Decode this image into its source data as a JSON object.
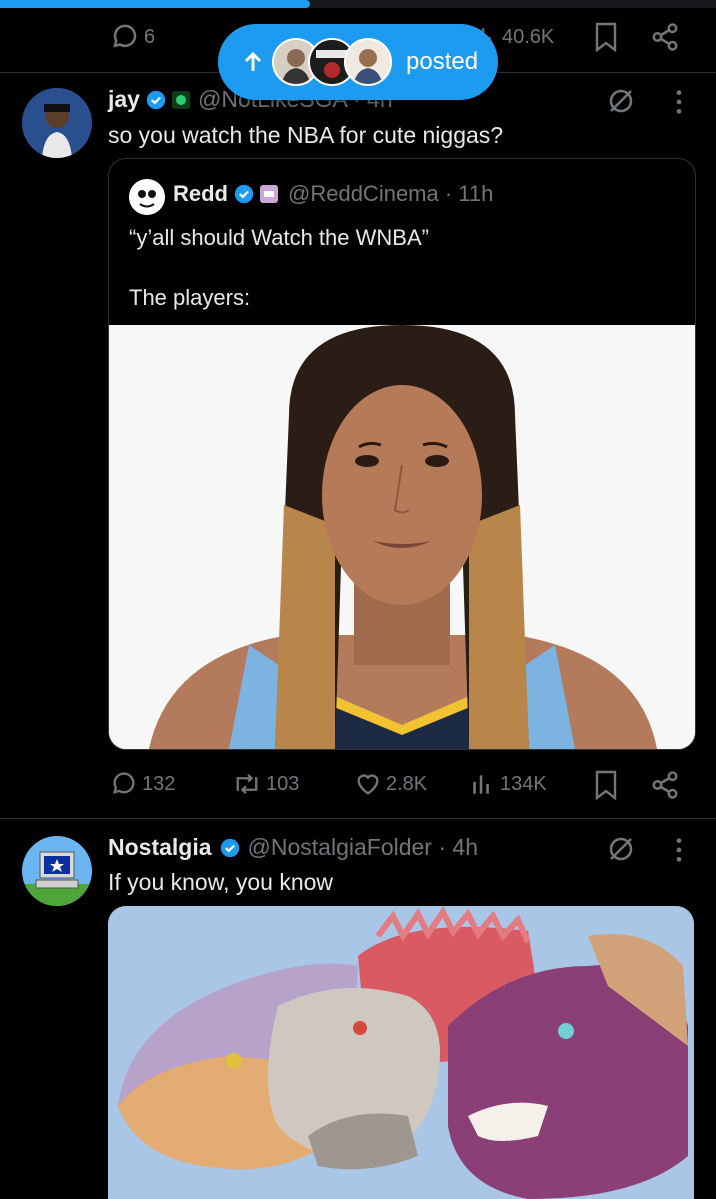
{
  "top_bar": {
    "reply_count": "6",
    "view_count": "40.6K"
  },
  "banner": {
    "label": "posted"
  },
  "post1": {
    "name": "jay",
    "handle": "@NotLikeSGA · 4h",
    "text": "so you watch the NBA for cute niggas?",
    "quote": {
      "name": "Redd",
      "handle": "@ReddCinema · 11h",
      "text_line1": "“y’all should Watch the WNBA”",
      "text_line2": "The players:"
    },
    "stats": {
      "replies": "132",
      "reposts": "103",
      "likes": "2.8K",
      "views": "134K"
    }
  },
  "post2": {
    "name": "Nostalgia",
    "handle": "@NostalgiaFolder · 4h",
    "text": "If you know, you know"
  },
  "colors": {
    "accent": "#1d9bf0",
    "muted": "#71767b",
    "divider": "#2f3336",
    "background": "#000000"
  }
}
